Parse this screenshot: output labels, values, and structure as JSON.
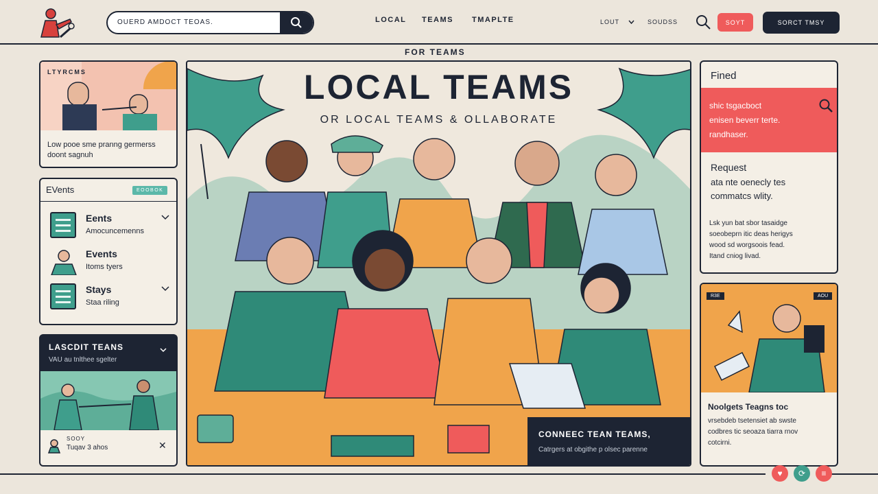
{
  "header": {
    "search_placeholder": "OUERD AMDOCT TEOAS.",
    "nav": [
      "LOCAL",
      "TEAMS",
      "TMAPLTE"
    ],
    "lout": "LOUT",
    "sounds": "SOUDSS",
    "btn_sort": "SOYT",
    "btn_cta": "SORCT TMSY"
  },
  "left": {
    "card1": {
      "tag": "LTYRCMS",
      "caption": "Low pooe sme pranng germerss doont sagnuh"
    },
    "events": {
      "title": "EVents",
      "badge": "EOOBOK",
      "items": [
        {
          "title": "Eents",
          "sub": "Amocuncemenns"
        },
        {
          "title": "Events",
          "sub": "Itoms tyers"
        },
        {
          "title": "Stays",
          "sub": "Staa riling"
        }
      ]
    },
    "promo": {
      "title": "LASCDIT TEANS",
      "sub": "VAU au tnlthee sgelter",
      "footer_top": "SOOY",
      "footer": "Tuqav 3 ahos"
    }
  },
  "hero": {
    "eyebrow": "FOR TEAMS",
    "title": "LOCAL TEAMS",
    "subtitle": "OR LOCAL TEAMS & OLLABORATE",
    "card_title": "CONNEEC TEAN TEAMS,",
    "card_sub": "Catrgers at obgithe p olsec parenne"
  },
  "right": {
    "find": {
      "title": "Fined",
      "alert": "shic tsgacboct\nenisen beverr terte.\nrandhaser.",
      "req_title": "Request",
      "req_body": "ata nte oenecly tes\ncommatcs wlity.",
      "fine": "Lsk yun bat sbor tasaidge\nsoeobeprn itic deas herigys\nwood sd worgsoois fead.\nItand cniog livad."
    },
    "promo": {
      "tag_l": "R3E",
      "tag_r": "AOU",
      "title": "Noolgets Teagns toc",
      "body": "vrsebdeb tsetensiet ab swste\ncodbres tic seoaza tiarra rnov\ncotcirni."
    }
  },
  "colors": {
    "navy": "#1d2433",
    "coral": "#ef5b5b",
    "teal": "#3f9e8c",
    "orange": "#f0a44b",
    "cream": "#ece6dc"
  }
}
